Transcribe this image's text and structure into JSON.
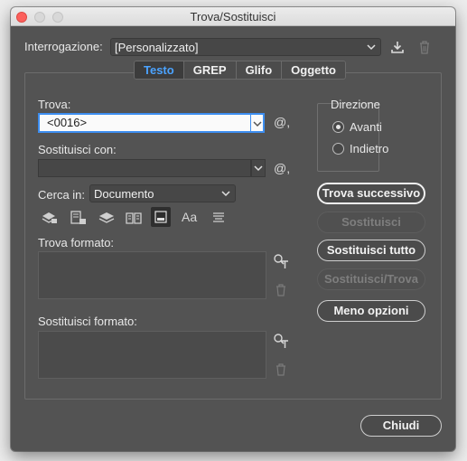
{
  "window": {
    "title": "Trova/Sostituisci"
  },
  "query": {
    "label": "Interrogazione:",
    "value": "[Personalizzato]",
    "save_icon": "save-query-icon",
    "delete_icon": "trash-icon"
  },
  "tabs": [
    {
      "label": "Testo",
      "active": true
    },
    {
      "label": "GREP",
      "active": false
    },
    {
      "label": "Glifo",
      "active": false
    },
    {
      "label": "Oggetto",
      "active": false
    }
  ],
  "find": {
    "label": "Trova:",
    "value": "<0016>",
    "special_glyph": "@,"
  },
  "replace": {
    "label": "Sostituisci con:",
    "value": "",
    "special_glyph": "@,"
  },
  "search_in": {
    "label": "Cerca in:",
    "value": "Documento"
  },
  "options_icons": [
    "locked-layers-icon",
    "locked-stories-icon",
    "hidden-layers-icon",
    "master-pages-icon",
    "footnotes-icon",
    "case-sensitive-icon",
    "whole-word-icon"
  ],
  "case_icon_text": "Aa",
  "find_format": {
    "label": "Trova formato:"
  },
  "replace_format": {
    "label": "Sostituisci formato:"
  },
  "direction": {
    "label": "Direzione",
    "options": [
      {
        "label": "Avanti",
        "checked": true
      },
      {
        "label": "Indietro",
        "checked": false
      }
    ]
  },
  "buttons": {
    "find_next": "Trova successivo",
    "replace": "Sostituisci",
    "replace_all": "Sostituisci tutto",
    "replace_find": "Sostituisci/Trova",
    "more_options": "Meno opzioni",
    "close": "Chiudi"
  }
}
